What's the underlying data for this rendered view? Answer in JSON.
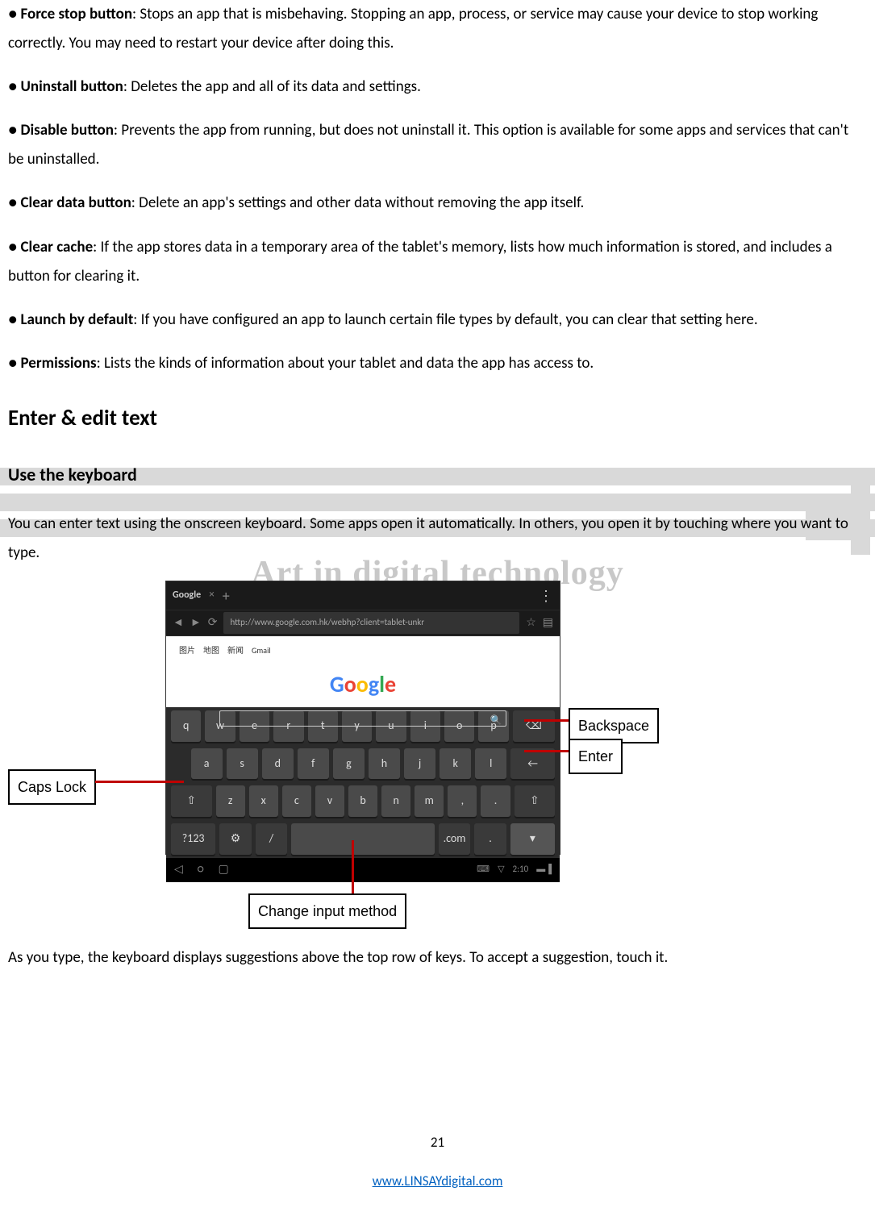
{
  "bullets": [
    {
      "term": "Force stop button",
      "desc": ": Stops an app that is misbehaving. Stopping an app, process, or service may cause your device to stop working correctly. You may need to restart your device after doing this."
    },
    {
      "term": "Uninstall button",
      "desc": ": Deletes the app and all of its data and settings."
    },
    {
      "term": "Disable button",
      "desc": ": Prevents the app from running, but does not uninstall it. This option is available for some apps and services that can't be uninstalled."
    },
    {
      "term": "Clear data button",
      "desc": ": Delete an app's settings and other data without removing the app itself."
    },
    {
      "term": "Clear cache",
      "desc": ": If the app stores data in a temporary area of the tablet's memory, lists how much information is stored, and includes a button for clearing it."
    },
    {
      "term": "Launch by default",
      "desc": ": If you have configured an app to launch certain file types by default, you can clear that setting here."
    },
    {
      "term": "Permissions",
      "desc": ": Lists the kinds of information about your tablet and data the app has access to."
    }
  ],
  "section_title": "Enter & edit text",
  "sub_title": "Use the keyboard",
  "intro_para": "You can enter text using the onscreen keyboard. Some apps open it automatically. In others, you open it by touching where you want to type.",
  "watermark_tagline": "Art in digital technology",
  "figure": {
    "tab_label": "Google",
    "url": "http://www.google.com.hk/webhp?client=tablet-unkr",
    "logo": "Google",
    "gbar": [
      "图片",
      "地图",
      "新闻",
      "Gmail"
    ],
    "row1": [
      "q",
      "w",
      "e",
      "r",
      "t",
      "y",
      "u",
      "i",
      "o",
      "p"
    ],
    "row2": [
      "a",
      "s",
      "d",
      "f",
      "g",
      "h",
      "j",
      "k",
      "l"
    ],
    "row3_shift": "⇧",
    "row3": [
      "z",
      "x",
      "c",
      "v",
      "b",
      "n",
      "m"
    ],
    "row4_sym": "?123",
    "row4_settings": "⚙",
    "row4_slash": "/",
    "row4_com": ".com",
    "row4_dot": ".",
    "backspace": "⌫",
    "enter": "←",
    "comma_key": ",",
    "input_method": "⌨",
    "clock": "2:10",
    "callouts": {
      "backspace": "Backspace",
      "enter": "Enter",
      "capslock": "Caps Lock",
      "change_input": "Change input method"
    }
  },
  "outro_para": "As you type, the keyboard displays suggestions above the top row of keys. To accept a suggestion, touch it.",
  "page_number": "21",
  "footer_url": "www.LINSAYdigital.com"
}
